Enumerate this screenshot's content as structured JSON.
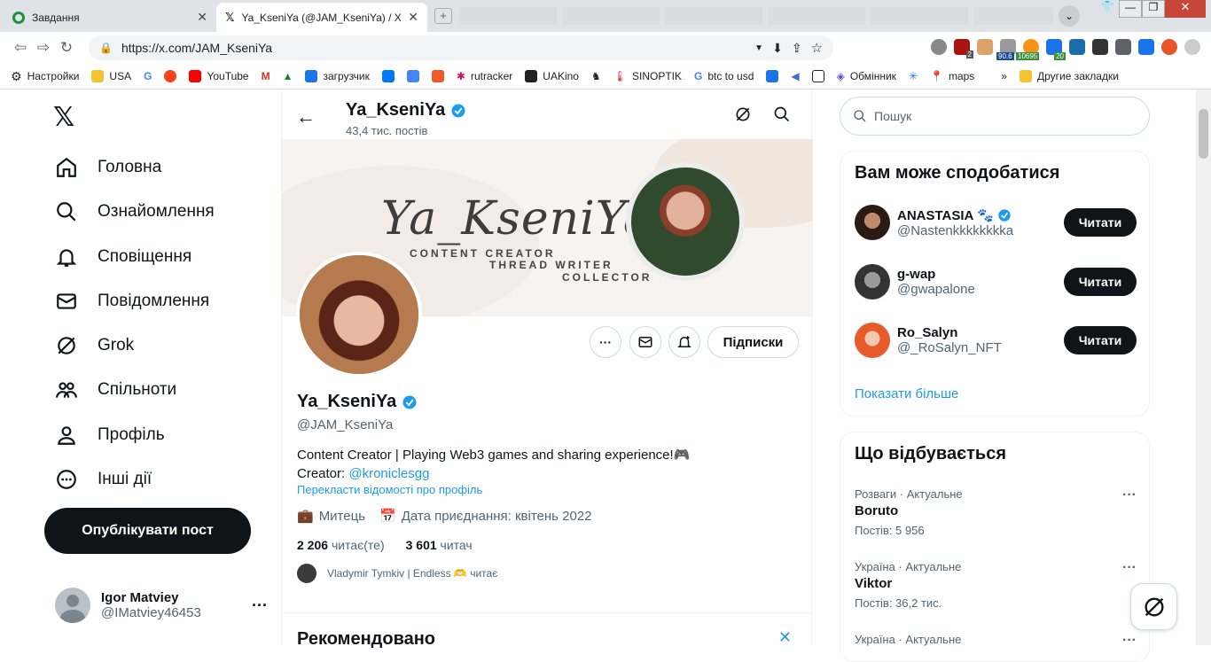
{
  "browser": {
    "tabs": [
      {
        "title": "Завдання",
        "active": false
      },
      {
        "title": "Ya_KseniYa (@JAM_KseniYa) / X",
        "active": true
      }
    ],
    "url": "https://x.com/JAM_KseniYa",
    "bookmarks": [
      "Настройки",
      "USA",
      "YouTube",
      "загрузчик",
      "rutracker",
      "UAKino",
      "SINOPTIK",
      "btc to usd",
      "Обмінник",
      "maps",
      "Другие закладки"
    ],
    "ext_badges": {
      "a": "2",
      "b": "90.6",
      "c": "10695",
      "d": "20"
    }
  },
  "nav": {
    "items": [
      "Головна",
      "Ознайомлення",
      "Сповіщення",
      "Повідомлення",
      "Grok",
      "Спільноти",
      "Профіль",
      "Інші дії"
    ],
    "post_button": "Опублікувати пост",
    "account_name": "Igor Matviey",
    "account_handle": "@IMatviey46453"
  },
  "profile": {
    "header_name": "Ya_KseniYa",
    "posts_count": "43,4 тис. постів",
    "banner_title": "Ya_KseniYa",
    "banner_lines": [
      "CONTENT CREATOR",
      "THREAD WRITER",
      "COLLECTOR"
    ],
    "follow_button": "Підписки",
    "name": "Ya_KseniYa",
    "handle": "@JAM_KseniYa",
    "bio_line1": "Content Creator | Playing Web3 games and sharing experience!🎮",
    "bio_creator_label": "Creator: ",
    "bio_creator_link": "@kroniclesgg",
    "translate": "Перекласти відомості про профіль",
    "category": "Митець",
    "joined": "Дата приєднання: квітень 2022",
    "following_count": "2 206",
    "following_label": "читає(те)",
    "followers_count": "3 601",
    "followers_label": "читач",
    "followed_by": "Vladymir Tymkiv | Endless 🫶 читає",
    "recommended": "Рекомендовано"
  },
  "right": {
    "search_placeholder": "Пошук",
    "who_title": "Вам може сподобатися",
    "who": [
      {
        "name": "ANASTASIA 🐾",
        "handle": "@Nastenkkkkkkkka",
        "verified": true,
        "button": "Читати"
      },
      {
        "name": "g-wap",
        "handle": "@gwapalone",
        "verified": false,
        "button": "Читати"
      },
      {
        "name": "Ro_Salyn",
        "handle": "@_RoSalyn_NFT",
        "verified": false,
        "button": "Читати"
      }
    ],
    "show_more": "Показати більше",
    "trends_title": "Що відбувається",
    "trends": [
      {
        "meta": "Розваги · Актуальне",
        "name": "Boruto",
        "count": "Постів: 5 956"
      },
      {
        "meta": "Україна · Актуальне",
        "name": "Viktor",
        "count": "Постів: 36,2 тис."
      },
      {
        "meta": "Україна · Актуальне",
        "name": "",
        "count": ""
      }
    ]
  },
  "colors": {
    "accent": "#1d9bf0",
    "dark": "#0f1419",
    "muted": "#536471"
  }
}
